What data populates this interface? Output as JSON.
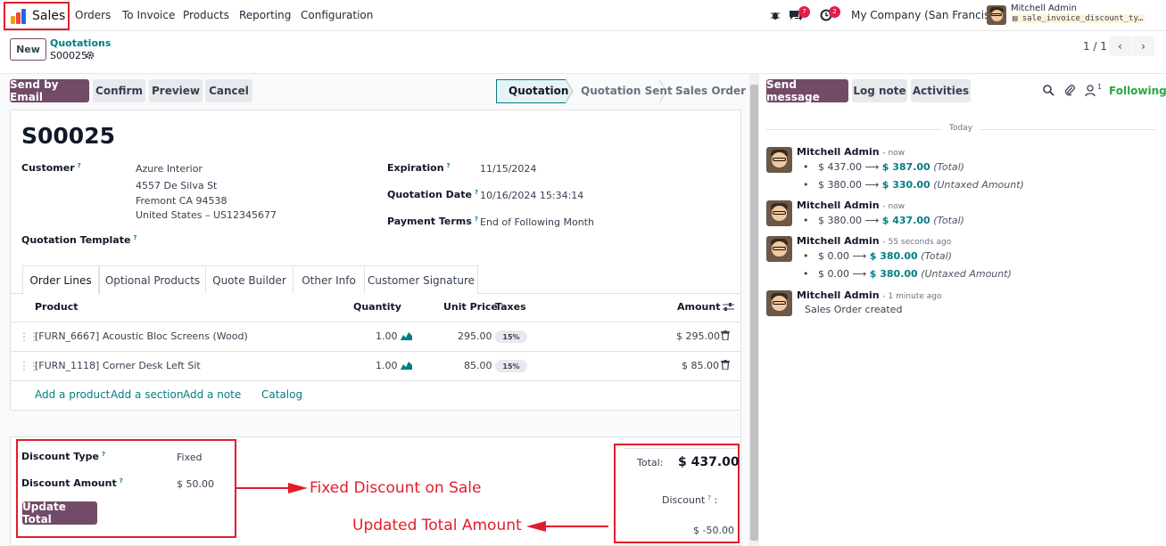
{
  "nav": {
    "app_name": "Sales",
    "menu": [
      "Orders",
      "To Invoice",
      "Products",
      "Reporting",
      "Configuration"
    ],
    "activity_badge": "7",
    "clock_badge": "2",
    "company": "My Company (San Francisco)",
    "user_name": "Mitchell Admin",
    "db_name": "sale_invoice_discount_ty…"
  },
  "control": {
    "new_label": "New",
    "breadcrumb_parent": "Quotations",
    "breadcrumb_current": "S00025",
    "pager": "1 / 1"
  },
  "actions": {
    "send_email": "Send by Email",
    "confirm": "Confirm",
    "preview": "Preview",
    "cancel": "Cancel",
    "stages": [
      "Quotation",
      "Quotation Sent",
      "Sales Order"
    ],
    "send_message": "Send message",
    "log_note": "Log note",
    "activities": "Activities",
    "followers_count": "1",
    "following": "Following"
  },
  "form": {
    "title": "S00025",
    "customer_label": "Customer",
    "customer_lines": [
      "Azure Interior",
      "4557 De Silva St",
      "Fremont CA 94538",
      "United States – US12345677"
    ],
    "template_label": "Quotation Template",
    "expiration_label": "Expiration",
    "expiration_value": "11/15/2024",
    "qdate_label": "Quotation Date",
    "qdate_value": "10/16/2024 15:34:14",
    "terms_label": "Payment Terms",
    "terms_value": "End of Following Month",
    "help": "?"
  },
  "tabs": [
    "Order Lines",
    "Optional Products",
    "Quote Builder",
    "Other Info",
    "Customer Signature"
  ],
  "table": {
    "headers": {
      "product": "Product",
      "quantity": "Quantity",
      "unit_price": "Unit Price",
      "taxes": "Taxes",
      "amount": "Amount"
    },
    "rows": [
      {
        "product": "[FURN_6667] Acoustic Bloc Screens (Wood)",
        "quantity": "1.00",
        "unit_price": "295.00",
        "tax": "15%",
        "amount": "$ 295.00"
      },
      {
        "product": "[FURN_1118] Corner Desk Left Sit",
        "quantity": "1.00",
        "unit_price": "85.00",
        "tax": "15%",
        "amount": "$ 85.00"
      }
    ],
    "add_product": "Add a product",
    "add_section": "Add a section",
    "add_note": "Add a note",
    "catalog": "Catalog"
  },
  "discount": {
    "type_label": "Discount Type",
    "type_value": "Fixed",
    "amount_label": "Discount Amount",
    "amount_value": "$ 50.00",
    "update_button": "Update Total"
  },
  "totals": {
    "total_label": "Total:",
    "total_value": "$ 437.00",
    "discount_label": "Discount",
    "discount_suffix": ":",
    "discount_value": "$ -50.00"
  },
  "annotations": {
    "fixed": "Fixed Discount on Sale",
    "updated": "Updated Total Amount"
  },
  "chatter": {
    "today": "Today",
    "messages": [
      {
        "author": "Mitchell Admin",
        "time": "- now",
        "lines": [
          {
            "old": "$ 437.00",
            "new": "$ 387.00",
            "field": "(Total)"
          },
          {
            "old": "$ 380.00",
            "new": "$ 330.00",
            "field": "(Untaxed Amount)"
          }
        ]
      },
      {
        "author": "Mitchell Admin",
        "time": "- now",
        "lines": [
          {
            "old": "$ 380.00",
            "new": "$ 437.00",
            "field": "(Total)"
          }
        ]
      },
      {
        "author": "Mitchell Admin",
        "time": "- 55 seconds ago",
        "lines": [
          {
            "old": "$ 0.00",
            "new": "$ 380.00",
            "field": "(Total)"
          },
          {
            "old": "$ 0.00",
            "new": "$ 380.00",
            "field": "(Untaxed Amount)"
          }
        ]
      },
      {
        "author": "Mitchell Admin",
        "time": "- 1 minute ago",
        "body": "Sales Order created"
      }
    ]
  },
  "colors": {
    "brand": "#714B67",
    "teal": "#017e84",
    "annotation": "#e11d2b"
  }
}
